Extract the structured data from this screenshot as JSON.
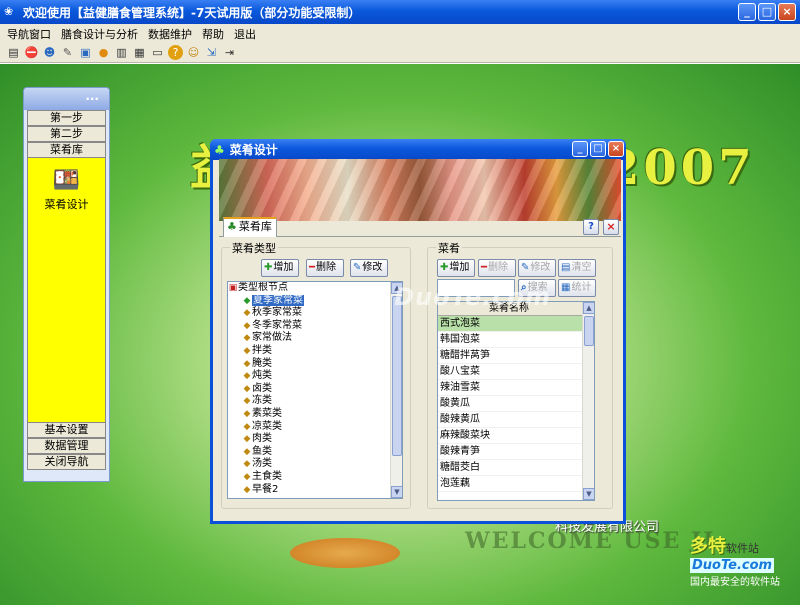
{
  "app": {
    "title": "欢迎使用【益健膳食管理系统】-7天试用版（部分功能受限制）",
    "menu": [
      "导航窗口",
      "膳食设计与分析",
      "数据维护",
      "帮助",
      "退出"
    ],
    "toolbar_icons": [
      "calculator-icon",
      "stop-icon",
      "users-icon",
      "edit-icon",
      "window-icon",
      "food-icon",
      "print-icon",
      "save-icon",
      "monitor-icon",
      "help-icon",
      "group-icon",
      "export-icon",
      "exit-icon"
    ]
  },
  "background": {
    "big_title": "益健膳食管理系统2007",
    "welcome": "WELCOME USE JI",
    "company": "科技发展有限公司",
    "watermark": "www.DuoTe.com",
    "logo_line1": "多特",
    "logo_line1_small": "软件站",
    "logo_line2": "DuoTe.com",
    "logo_line3": "国内最安全的软件站"
  },
  "nav": {
    "header": "...",
    "buttons_top": [
      "第一步",
      "第二步",
      "菜肴库"
    ],
    "active_label": "菜肴设计",
    "buttons_bottom": [
      "基本设置",
      "数据管理",
      "关闭导航"
    ]
  },
  "dialog": {
    "title": "菜肴设计",
    "tab": "菜肴库",
    "help_icon": "?",
    "close_icon": "×",
    "left_group": {
      "legend": "菜肴类型",
      "buttons": [
        "增加",
        "删除",
        "修改"
      ],
      "tree_items": [
        "类型根节点",
        "夏季家常菜",
        "秋季家常菜",
        "冬季家常菜",
        "家常做法",
        "拌类",
        "腌类",
        "炖类",
        "卤类",
        "冻类",
        "素菜类",
        "凉菜类",
        "肉类",
        "鱼类",
        "汤类",
        "主食类",
        "早餐2"
      ],
      "selected_index": 1
    },
    "right_group": {
      "legend": "菜肴",
      "buttons": [
        "增加",
        "删除",
        "修改",
        "清空"
      ],
      "buttons2": [
        "搜索",
        "统计"
      ],
      "list_header": "菜肴名称",
      "list_items": [
        "西式泡菜",
        "韩国泡菜",
        "糖醋拌莴笋",
        "酸八宝菜",
        "辣油雪菜",
        "酸黄瓜",
        "酸辣黄瓜",
        "麻辣酸菜块",
        "酸辣青笋",
        "糖醋茭白",
        "泡莲藕"
      ],
      "selected_index": 0
    }
  }
}
